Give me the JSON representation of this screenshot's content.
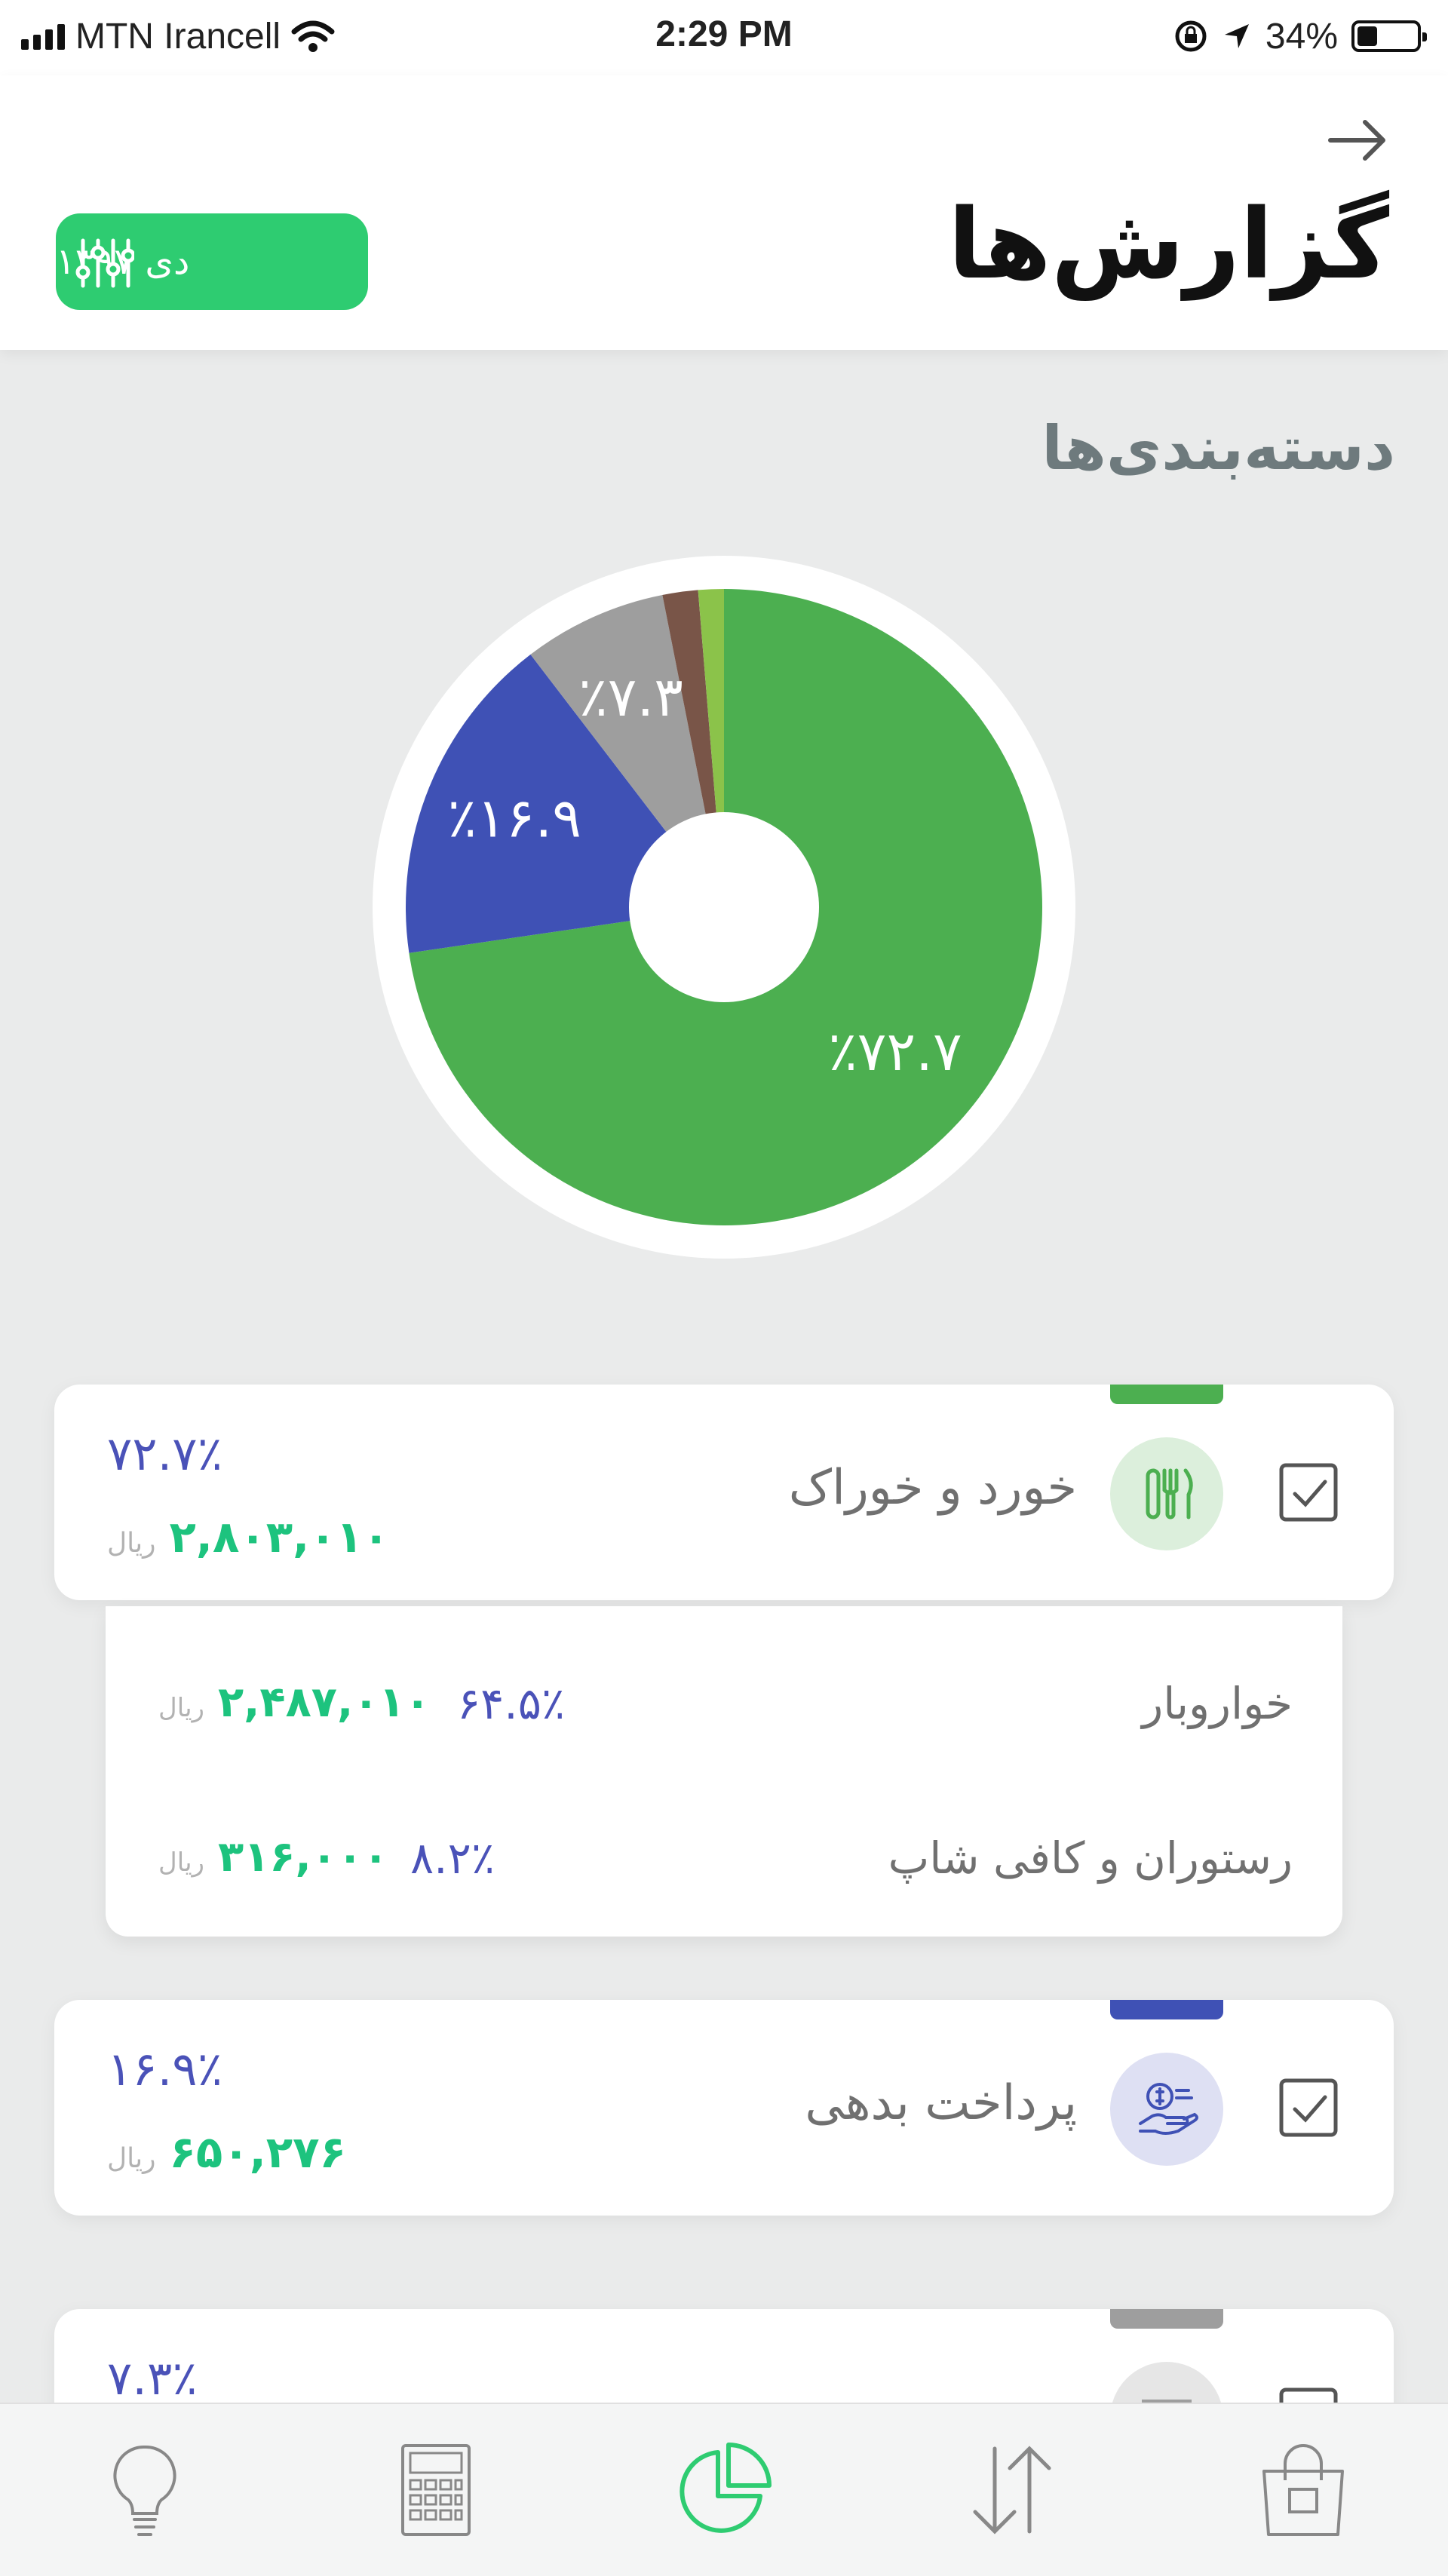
{
  "status_bar": {
    "carrier": "MTN Irancell",
    "time": "2:29 PM",
    "battery": "34%",
    "battery_level": 0.34,
    "icons": [
      "signal-icon",
      "wifi-icon",
      "rotation-lock-icon",
      "location-icon",
      "battery-icon"
    ]
  },
  "header": {
    "title": "گزارش‌ها",
    "back_icon": "arrow-right-icon",
    "date_filter": {
      "label": "دی ۱۳۹۷",
      "icon": "sliders-icon"
    }
  },
  "section_title": "دسته‌بندی‌ها",
  "chart_data": {
    "type": "pie",
    "slices": [
      {
        "label": "خورد و خوراک",
        "value": 72.7,
        "label_text": "٪۷۲.۷",
        "color": "#4caf50"
      },
      {
        "label": "پرداخت بدهی",
        "value": 16.9,
        "label_text": "٪۱۶.۹",
        "color": "#3f51b5"
      },
      {
        "label": "",
        "value": 7.3,
        "label_text": "٪۷.۳",
        "color": "#9e9e9e"
      },
      {
        "label": "",
        "value": 1.8,
        "label_text": "",
        "color": "#795548"
      },
      {
        "label": "",
        "value": 1.3,
        "label_text": "",
        "color": "#8bc34a"
      }
    ]
  },
  "categories": [
    {
      "name": "خورد و خوراک",
      "percent": "۷۲.۷٪",
      "amount": "۲,۸۰۳,۰۱۰",
      "currency": "ریال",
      "color": "#4caf50",
      "icon": "fork-knife-icon",
      "subcategories": [
        {
          "name": "خواروبار",
          "percent": "۶۴.۵٪",
          "amount": "۲,۴۸۷,۰۱۰",
          "currency": "ریال"
        },
        {
          "name": "رستوران و کافی شاپ",
          "percent": "۸.۲٪",
          "amount": "۳۱۶,۰۰۰",
          "currency": "ریال"
        }
      ]
    },
    {
      "name": "پرداخت بدهی",
      "percent": "۱۶.۹٪",
      "amount": "۶۵۰,۲۷۶",
      "currency": "ریال",
      "color": "#3f51b5",
      "icon": "hand-coin-icon"
    },
    {
      "name": "",
      "percent": "۷.۳٪",
      "color": "#9e9e9e",
      "icon": "receipt-icon"
    }
  ],
  "bottom_nav": [
    {
      "icon": "lightbulb-icon",
      "active": false
    },
    {
      "icon": "calculator-icon",
      "active": false
    },
    {
      "icon": "pie-chart-icon",
      "active": true
    },
    {
      "icon": "arrows-up-down-icon",
      "active": false
    },
    {
      "icon": "shopping-bag-icon",
      "active": false
    }
  ],
  "colors": {
    "accent": "#2ecc71",
    "money": "#1dc37e",
    "percent": "#4a52b8"
  }
}
